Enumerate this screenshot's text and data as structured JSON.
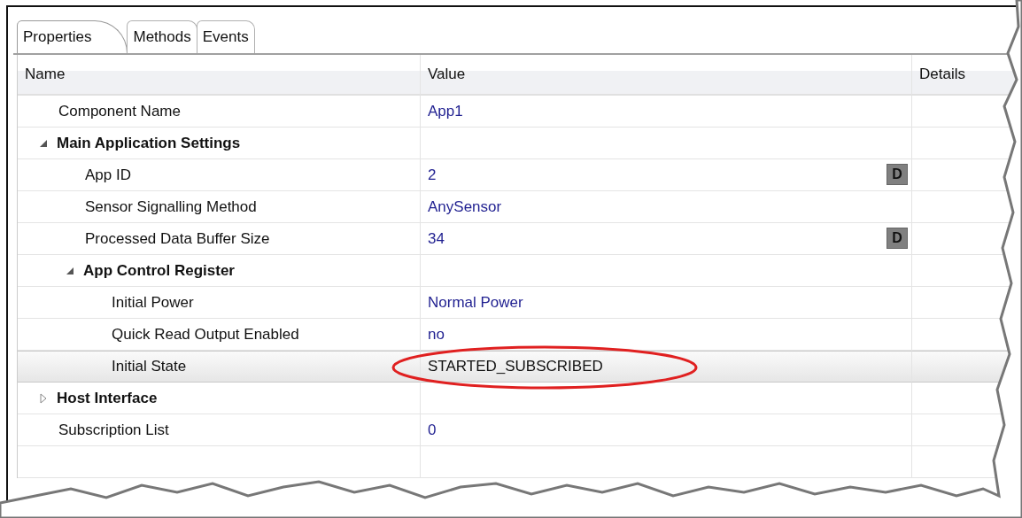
{
  "tabs": [
    {
      "label": "Properties",
      "selected": true
    },
    {
      "label": "Methods",
      "selected": false
    },
    {
      "label": "Events",
      "selected": false
    }
  ],
  "table": {
    "columns": [
      "Name",
      "Value",
      "Details"
    ],
    "rows": [
      {
        "name": "Component Name",
        "value": "App1",
        "selected": false
      },
      {
        "name": "Main Application Settings",
        "group": true,
        "expanded": true,
        "selected": false,
        "children": [
          {
            "name": "App ID",
            "value": "2",
            "details_button": "D",
            "selected": false
          },
          {
            "name": "Sensor Signalling Method",
            "value": "AnySensor",
            "selected": false
          },
          {
            "name": "Processed Data Buffer Size",
            "value": "34",
            "details_button": "D",
            "selected": false
          },
          {
            "name": "App Control Register",
            "group": true,
            "expanded": true,
            "selected": false,
            "children": [
              {
                "name": "Initial Power",
                "value": "Normal Power",
                "selected": false
              },
              {
                "name": "Quick Read Output Enabled",
                "value": "no",
                "selected": false
              },
              {
                "name": "Initial State",
                "value": "STARTED_SUBSCRIBED",
                "selected": true,
                "circled": true
              }
            ]
          }
        ]
      },
      {
        "name": "Host Interface",
        "group": true,
        "expanded": false,
        "selected": false
      },
      {
        "name": "Subscription List",
        "value": "0",
        "selected": false
      }
    ]
  }
}
